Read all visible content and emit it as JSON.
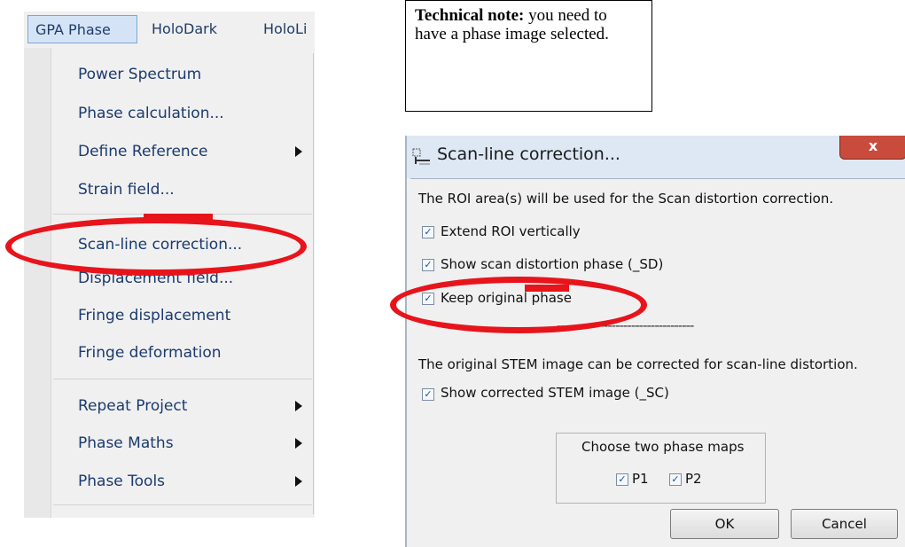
{
  "menu": {
    "menubar": [
      "GPA Phase",
      "HoloDark",
      "HoloLi"
    ],
    "items": [
      {
        "label": "Power Spectrum"
      },
      {
        "label": "Phase calculation..."
      },
      {
        "label": "Define Reference"
      },
      {
        "label": "Strain field..."
      },
      {
        "label": "Scan-line correction..."
      },
      {
        "label": "Displacement field..."
      },
      {
        "label": "Fringe displacement"
      },
      {
        "label": "Fringe deformation"
      },
      {
        "label": "Repeat Project"
      },
      {
        "label": "Phase Maths"
      },
      {
        "label": "Phase Tools"
      }
    ]
  },
  "note": {
    "bold": "Technical note:",
    "text": " you need to have a phase image selected."
  },
  "dialog": {
    "title": "Scan-line correction...",
    "close_label": "x",
    "intro": "The ROI area(s) will be used for the Scan distortion correction.",
    "checks": [
      {
        "label": "Extend ROI vertically",
        "checked": true
      },
      {
        "label": "Show scan distortion phase (_SD)",
        "checked": true
      },
      {
        "label": "Keep original phase",
        "checked": true
      }
    ],
    "separator": "-----------------------------------",
    "stem_text": "The original STEM image can be corrected for scan-line distortion.",
    "stem_check": {
      "label": "Show corrected STEM image (_SC)",
      "checked": true
    },
    "group_label": "Choose two phase maps",
    "p1": {
      "label": "P1",
      "checked": true
    },
    "p2": {
      "label": "P2",
      "checked": true
    },
    "ok": "OK",
    "cancel": "Cancel"
  },
  "colors": {
    "annotation": "#e8141b",
    "menu_text": "#1b3a6e"
  }
}
